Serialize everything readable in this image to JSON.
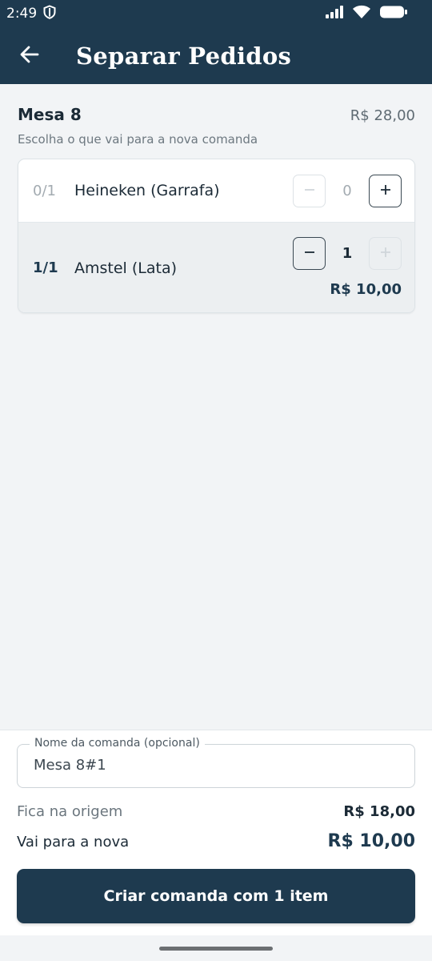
{
  "status_bar": {
    "time": "2:49"
  },
  "app_bar": {
    "title": "Separar Pedidos"
  },
  "order": {
    "table_name": "Mesa 8",
    "total": "R$ 28,00",
    "subtitle": "Escolha o que vai para a nova comanda"
  },
  "items": [
    {
      "fraction": "0/1",
      "name": "Heineken (Garrafa)",
      "quantity": "0"
    },
    {
      "fraction": "1/1",
      "name": "Amstel (Lata)",
      "quantity": "1",
      "price": "R$ 10,00"
    }
  ],
  "form": {
    "label": "Nome da comanda (opcional)",
    "value": "Mesa 8#1"
  },
  "summary": {
    "stays_label": "Fica na origem",
    "stays_value": "R$ 18,00",
    "goes_label": "Vai para a nova",
    "goes_value": "R$ 10,00"
  },
  "cta_label": "Criar comanda com 1 item",
  "colors": {
    "primary": "#1e3a4f",
    "background": "#f2f4f6",
    "muted": "#a3abb1"
  }
}
